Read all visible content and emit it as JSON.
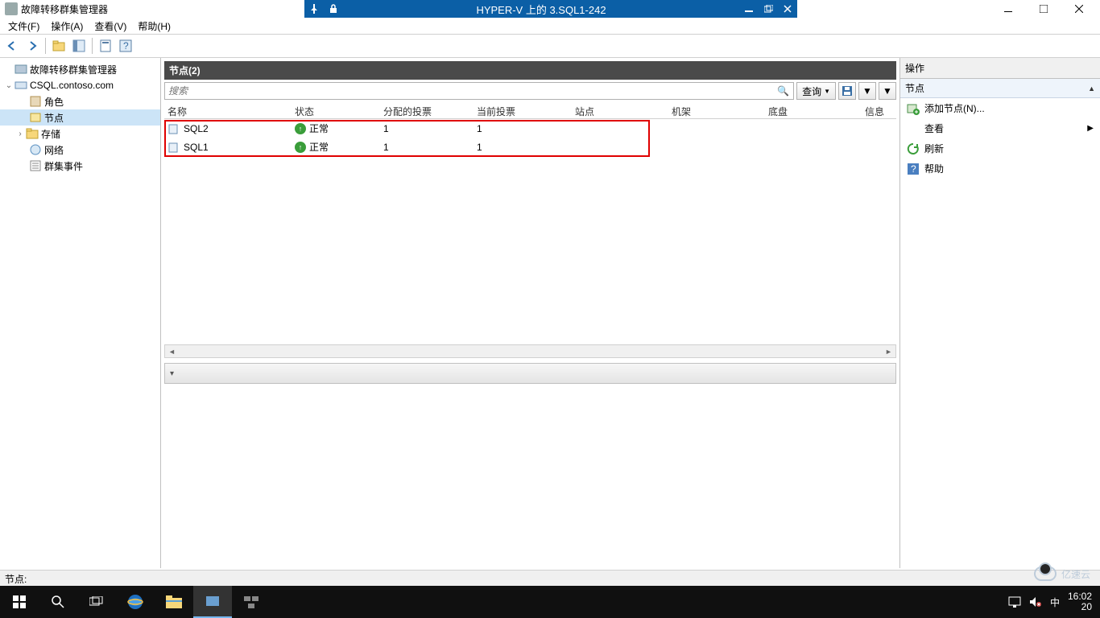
{
  "host_window": {
    "vm_title": "HYPER-V 上的 3.SQL1-242"
  },
  "app": {
    "title": "故障转移群集管理器"
  },
  "menu": {
    "file": "文件(F)",
    "action": "操作(A)",
    "view": "查看(V)",
    "help": "帮助(H)"
  },
  "tree": {
    "root": "故障转移群集管理器",
    "cluster": "CSQL.contoso.com",
    "roles": "角色",
    "nodes": "节点",
    "storage": "存储",
    "networks": "网络",
    "events": "群集事件"
  },
  "center": {
    "header": "节点(2)",
    "search_placeholder": "搜索",
    "query_btn": "查询",
    "columns": {
      "name": "名称",
      "state": "状态",
      "assigned": "分配的投票",
      "current": "当前投票",
      "site": "站点",
      "rack": "机架",
      "chassis": "底盘",
      "info": "信息"
    },
    "rows": [
      {
        "name": "SQL2",
        "state": "正常",
        "assigned": "1",
        "current": "1"
      },
      {
        "name": "SQL1",
        "state": "正常",
        "assigned": "1",
        "current": "1"
      }
    ]
  },
  "actions": {
    "title": "操作",
    "group": "节点",
    "add_node": "添加节点(N)...",
    "view": "查看",
    "refresh": "刷新",
    "help": "帮助"
  },
  "statusbar": "节点:",
  "taskbar": {
    "time": "16:02",
    "date_partial": "20",
    "ime": "中"
  },
  "watermark": "亿速云"
}
